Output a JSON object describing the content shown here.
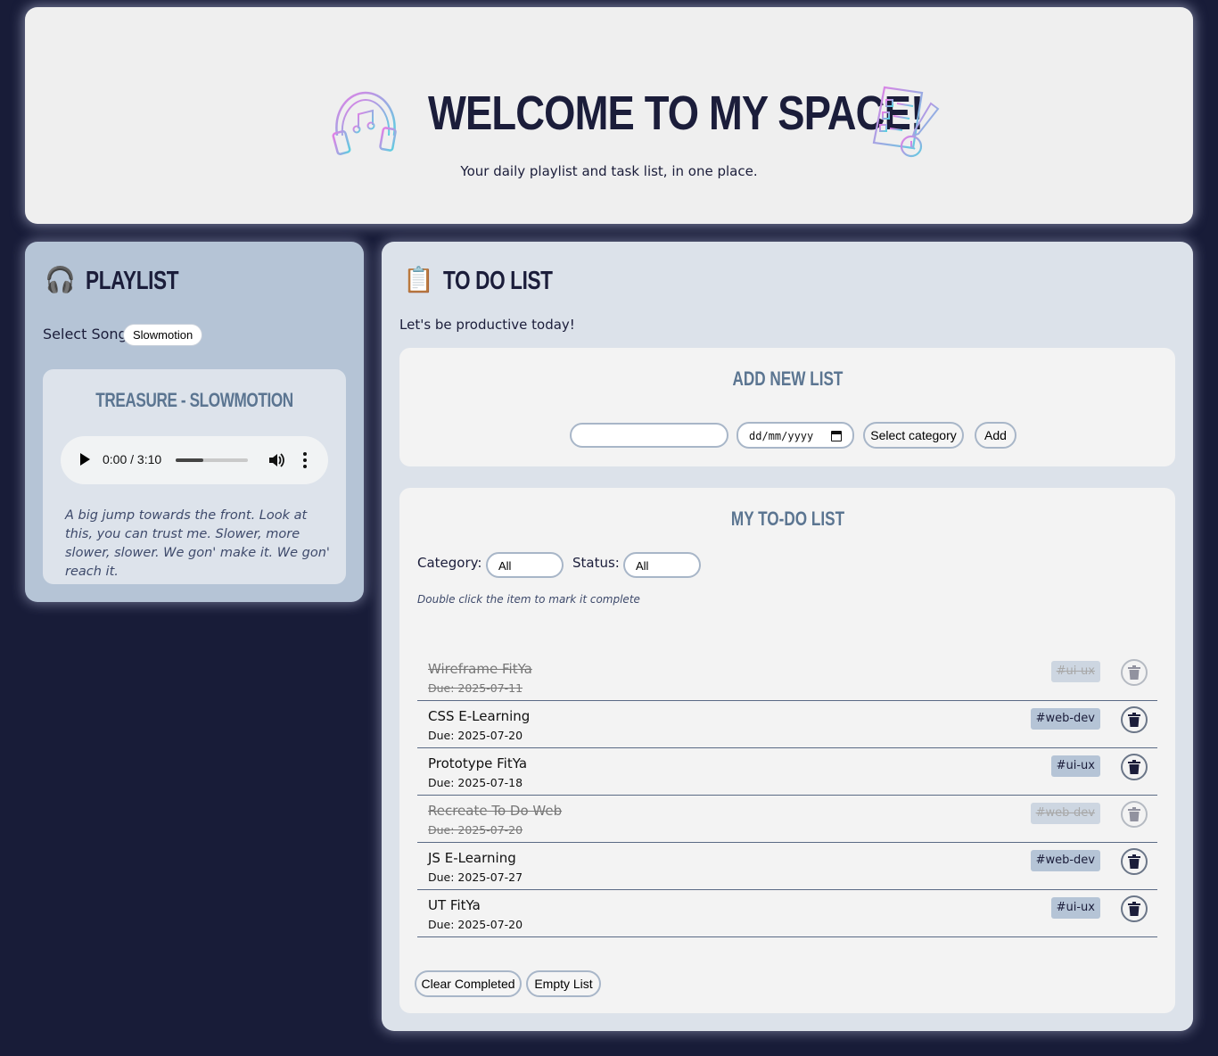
{
  "header": {
    "title": "WELCOME TO MY SPACE!",
    "subtitle": "Your daily playlist and task list, in one place.",
    "left_icon": "headphones-icon",
    "right_icon": "task-clipboard-icon"
  },
  "playlist": {
    "title": "PLAYLIST",
    "emoji": "🎧",
    "select_label": "Select Song:",
    "selected_song": "Slowmotion",
    "now_playing": "TREASURE - SLOWMOTION",
    "audio": {
      "time": "0:00 / 3:10",
      "progress": 0.38
    },
    "lyric": "A big jump towards the front. Look at this, you can trust me. Slower, more slower, slower. We gon' make it. We gon' reach it."
  },
  "todo": {
    "title": "TO DO LIST",
    "emoji": "📋",
    "subtitle": "Let's be productive today!",
    "add_card": {
      "title": "ADD NEW LIST",
      "task_input_value": "",
      "date_placeholder": "dd/mm/yyyy",
      "category_button": "Select category",
      "add_button": "Add"
    },
    "list_card": {
      "title": "MY TO-DO LIST",
      "category_label": "Category:",
      "category_value": "All",
      "status_label": "Status:",
      "status_value": "All",
      "hint": "Double click the item to mark it complete",
      "tasks": [
        {
          "name": "Wireframe FitYa",
          "due": "Due: 2025-07-11",
          "tag": "#ui-ux",
          "done": true
        },
        {
          "name": "CSS E-Learning",
          "due": "Due: 2025-07-20",
          "tag": "#web-dev",
          "done": false
        },
        {
          "name": "Prototype FitYa",
          "due": "Due: 2025-07-18",
          "tag": "#ui-ux",
          "done": false
        },
        {
          "name": "Recreate To Do Web",
          "due": "Due: 2025-07-20",
          "tag": "#web-dev",
          "done": true
        },
        {
          "name": "JS E-Learning",
          "due": "Due: 2025-07-27",
          "tag": "#web-dev",
          "done": false
        },
        {
          "name": "UT FitYa",
          "due": "Due: 2025-07-20",
          "tag": "#ui-ux",
          "done": false
        }
      ],
      "clear_completed": "Clear Completed",
      "empty_list": "Empty List"
    }
  },
  "colors": {
    "background": "#181c38",
    "card_light": "#efefef",
    "playlist_bg": "#b5c4d6",
    "todo_bg": "#dce2ea",
    "accent_title": "#5b7591",
    "text_dark": "#1b1d3a"
  }
}
